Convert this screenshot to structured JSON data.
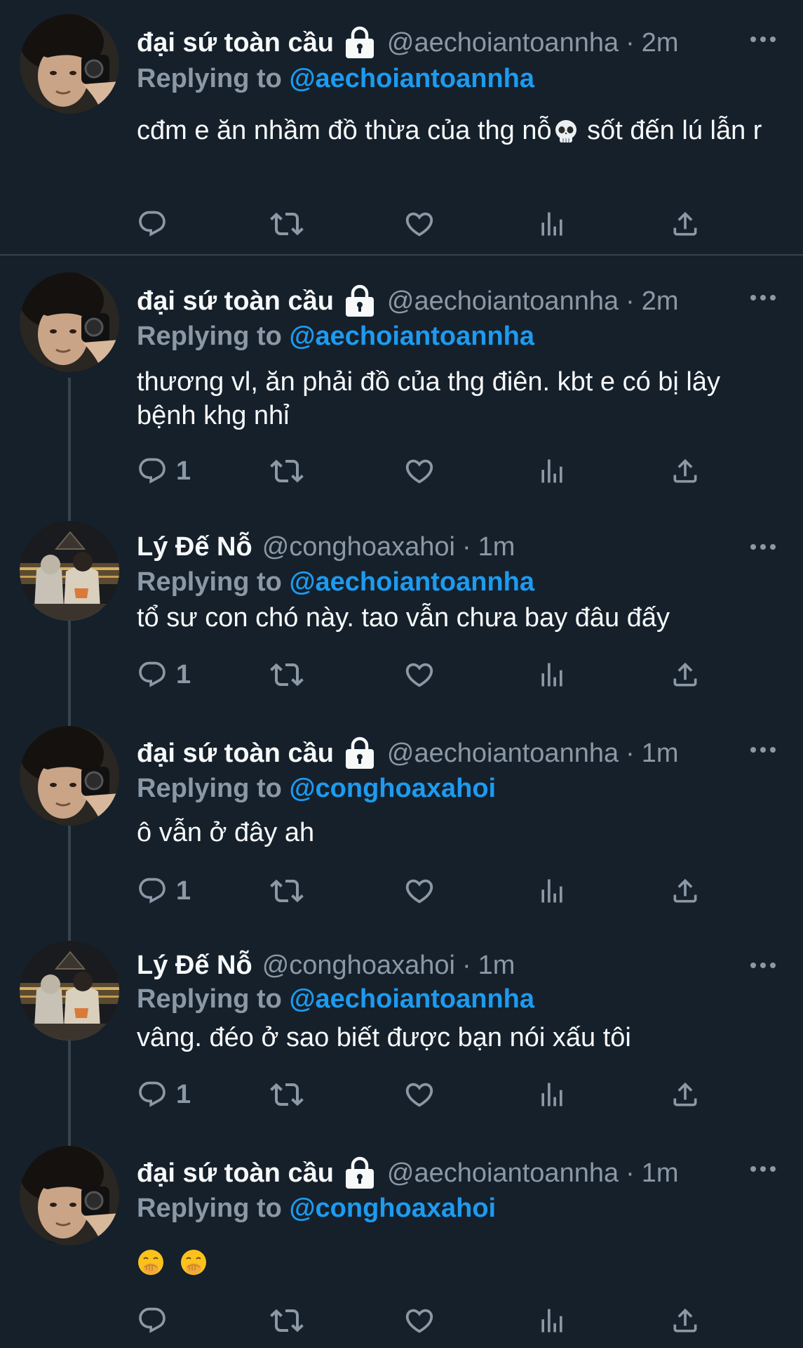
{
  "tweets": [
    {
      "name": "đại sứ toàn cầu",
      "handle": "@aechoiantoannha",
      "dot": "·",
      "time": "2m",
      "replying_label": "Replying to",
      "replying_to": "@aechoiantoannha",
      "text": "cđm e ăn nhầm đồ thừa của thg nỗ",
      "text_after_emoji": " sốt đến lú lẫn r",
      "reply_count": ""
    },
    {
      "name": "đại sứ toàn cầu",
      "handle": "@aechoiantoannha",
      "dot": "·",
      "time": "2m",
      "replying_label": "Replying to",
      "replying_to": "@aechoiantoannha",
      "text": "thương vl, ăn phải đồ của thg điên. kbt e có bị lây bệnh khg nhỉ",
      "reply_count": "1"
    },
    {
      "name": "Lý Đế Nỗ",
      "handle": "@conghoaxahoi",
      "dot": "·",
      "time": "1m",
      "replying_label": "Replying to",
      "replying_to": "@aechoiantoannha",
      "text": "tổ sư con chó này. tao vẫn chưa bay đâu đấy",
      "reply_count": "1"
    },
    {
      "name": "đại sứ toàn cầu",
      "handle": "@aechoiantoannha",
      "dot": "·",
      "time": "1m",
      "replying_label": "Replying to",
      "replying_to": "@conghoaxahoi",
      "text": "ô vẫn ở đây ah",
      "reply_count": "1"
    },
    {
      "name": "Lý Đế Nỗ",
      "handle": "@conghoaxahoi",
      "dot": "·",
      "time": "1m",
      "replying_label": "Replying to",
      "replying_to": "@aechoiantoannha",
      "text": "vâng. đéo ở sao biết được bạn nói xấu tôi",
      "reply_count": "1"
    },
    {
      "name": "đại sứ toàn cầu",
      "handle": "@aechoiantoannha",
      "dot": "·",
      "time": "1m",
      "replying_label": "Replying to",
      "replying_to": "@conghoaxahoi",
      "text": "",
      "reply_count": ""
    }
  ],
  "icons": {
    "reply": "reply-icon",
    "retweet": "retweet-icon",
    "like": "heart-icon",
    "views": "views-icon",
    "share": "share-icon",
    "more": "more-icon",
    "lock": "lock-icon",
    "emoji_skull": "skull-emoji",
    "emoji_hand_over_mouth": "hand-over-mouth-emoji"
  },
  "colors": {
    "background": "#15202b",
    "text": "#f7f9f9",
    "muted": "#8b98a5",
    "accent": "#1d9bf0",
    "divider": "#38444d"
  }
}
